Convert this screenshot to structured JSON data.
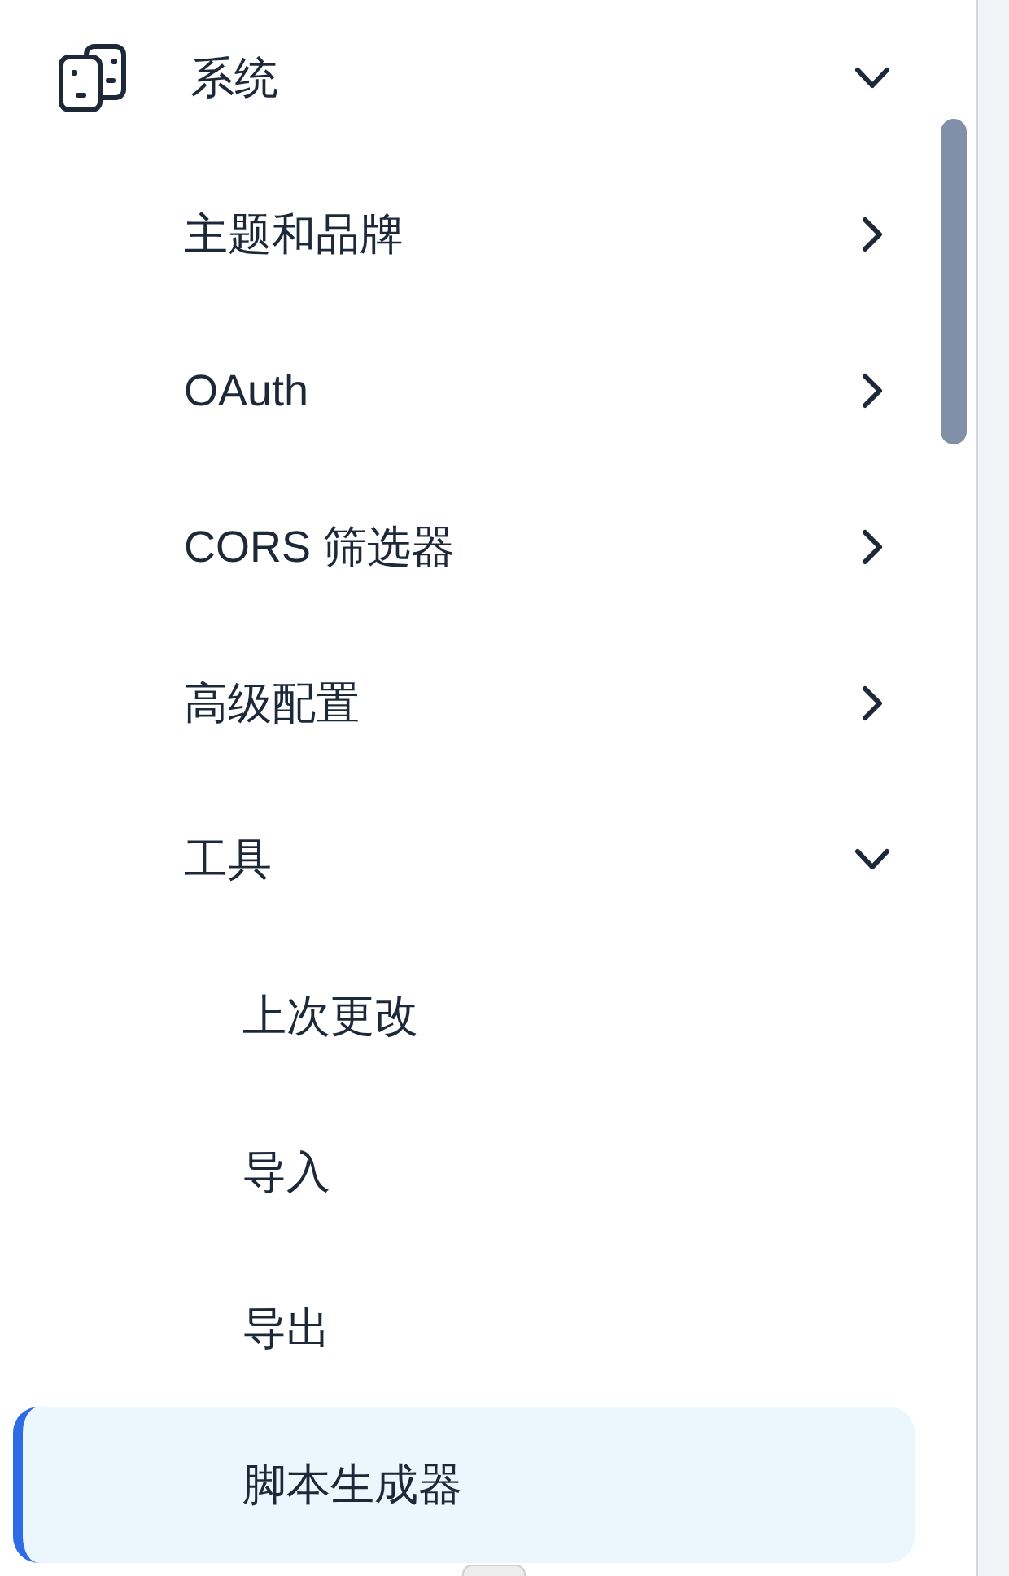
{
  "sidebar": {
    "items": [
      {
        "label": "系统",
        "kind": "group",
        "expanded": true,
        "selected": false,
        "children": [
          {
            "label": "主题和品牌",
            "kind": "group",
            "expanded": false,
            "selected": false
          },
          {
            "label": "OAuth",
            "kind": "group",
            "expanded": false,
            "selected": false
          },
          {
            "label": "CORS 筛选器",
            "kind": "group",
            "expanded": false,
            "selected": false
          },
          {
            "label": "高级配置",
            "kind": "group",
            "expanded": false,
            "selected": false
          },
          {
            "label": "工具",
            "kind": "group",
            "expanded": true,
            "selected": false,
            "children": [
              {
                "label": "上次更改",
                "kind": "link",
                "selected": false
              },
              {
                "label": "导入",
                "kind": "link",
                "selected": false
              },
              {
                "label": "导出",
                "kind": "link",
                "selected": false
              },
              {
                "label": "脚本生成器",
                "kind": "link",
                "selected": true
              }
            ]
          }
        ]
      }
    ]
  }
}
